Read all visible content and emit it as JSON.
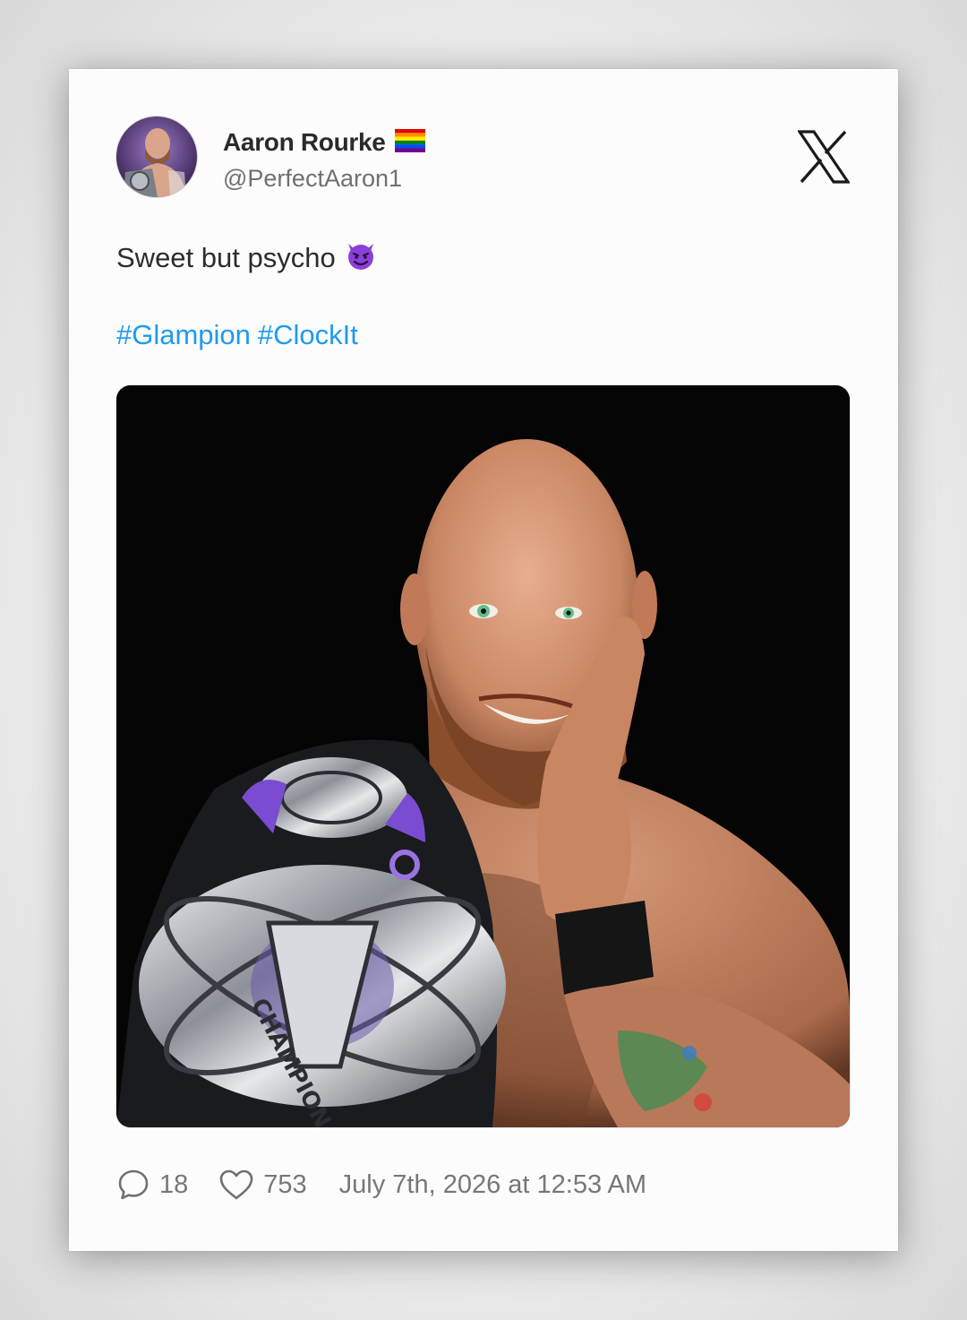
{
  "post": {
    "author": {
      "display_name": "Aaron Rourke",
      "handle": "@PerfectAaron1",
      "name_badge_icon": "rainbow-flag-icon",
      "avatar_icon": "profile-avatar"
    },
    "platform_logo_icon": "x-logo-icon",
    "text": "Sweet but psycho",
    "text_emoji_icon": "smiling-devil-icon",
    "hashtags": [
      "#Glampion",
      "#ClockIt"
    ],
    "media": {
      "icon": "wrestler-with-championship-belt-photo",
      "belt_text": "CHAMPION"
    },
    "stats": {
      "replies_icon": "comment-bubble-icon",
      "replies": "18",
      "likes_icon": "heart-icon",
      "likes": "753"
    },
    "timestamp": "July 7th, 2026 at 12:53 AM"
  },
  "colors": {
    "hashtag": "#1d9bf0",
    "card_background": "#fcfcfc",
    "muted_text": "#777777",
    "devil_purple": "#8b3fd9"
  }
}
